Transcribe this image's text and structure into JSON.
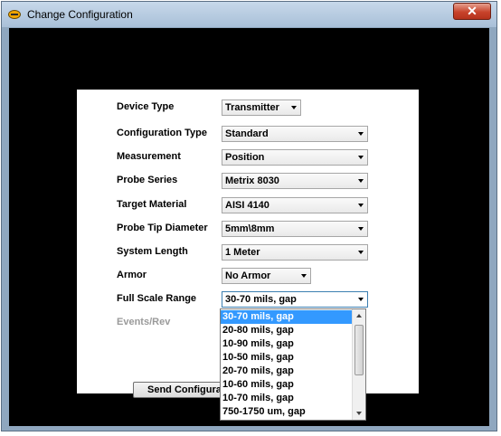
{
  "window": {
    "title": "Change Configuration",
    "close_label": "✕"
  },
  "form": {
    "device_type": {
      "label": "Device Type",
      "value": "Transmitter"
    },
    "configuration_type": {
      "label": "Configuration Type",
      "value": "Standard"
    },
    "measurement": {
      "label": "Measurement",
      "value": "Position"
    },
    "probe_series": {
      "label": "Probe Series",
      "value": "Metrix 8030"
    },
    "target_material": {
      "label": "Target Material",
      "value": "AISI 4140"
    },
    "probe_tip_diameter": {
      "label": "Probe Tip Diameter",
      "value": "5mm\\8mm"
    },
    "system_length": {
      "label": "System Length",
      "value": "1 Meter"
    },
    "armor": {
      "label": "Armor",
      "value": "No Armor"
    },
    "full_scale_range": {
      "label": "Full Scale Range",
      "value": "30-70 mils, gap"
    },
    "events_rev": {
      "label": "Events/Rev"
    },
    "send_button": "Send Configurat"
  },
  "dropdown": {
    "options": [
      "30-70 mils, gap",
      "20-80 mils, gap",
      "10-90 mils, gap",
      "10-50 mils, gap",
      "20-70 mils, gap",
      "10-60 mils, gap",
      "10-70 mils, gap",
      "750-1750 um, gap"
    ],
    "selected_index": 0
  },
  "colors": {
    "selection": "#3399ff",
    "client_background": "#000000",
    "close_button": "#c8432b"
  }
}
